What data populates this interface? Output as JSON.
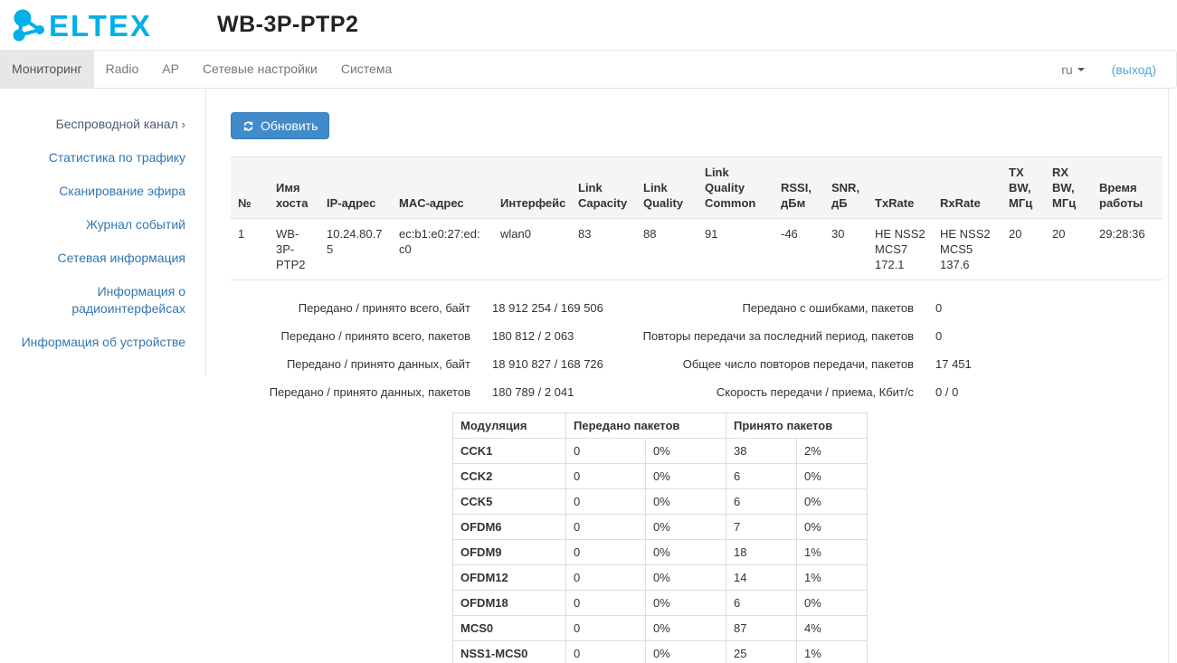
{
  "brand": {
    "logo_text": "ELTEX",
    "logo_color": "#00b0e6",
    "device_title": "WB-3P-PTP2"
  },
  "navbar": {
    "tabs": [
      {
        "label": "Мониторинг",
        "active": true
      },
      {
        "label": "Radio",
        "active": false
      },
      {
        "label": "AP",
        "active": false
      },
      {
        "label": "Сетевые настройки",
        "active": false
      },
      {
        "label": "Система",
        "active": false
      }
    ],
    "language": "ru",
    "logout_label": "(выход)"
  },
  "sidebar": {
    "items": [
      {
        "label": "Беспроводной канал",
        "chevron": "›",
        "active": true
      },
      {
        "label": "Статистика по трафику",
        "active": false
      },
      {
        "label": "Сканирование эфира",
        "active": false
      },
      {
        "label": "Журнал событий",
        "active": false
      },
      {
        "label": "Сетевая информация",
        "active": false
      },
      {
        "label": "Информация о радиоинтерфейсах",
        "active": false
      },
      {
        "label": "Информация об устройстве",
        "active": false
      }
    ]
  },
  "main": {
    "refresh_button": {
      "label": "Обновить"
    },
    "wireless_table": {
      "headers": [
        "№",
        "Имя хоста",
        "IP-адрес",
        "MAC-адрес",
        "Интерфейс",
        "Link Capacity",
        "Link Quality",
        "Link Quality Common",
        "RSSI, дБм",
        "SNR, дБ",
        "TxRate",
        "RxRate",
        "TX BW, МГц",
        "RX BW, МГц",
        "Время работы"
      ],
      "row": [
        "1",
        "WB-3P-PTP2",
        "10.24.80.75",
        "ec:b1:e0:27:ed:c0",
        "wlan0",
        "83",
        "88",
        "91",
        "-46",
        "30",
        "HE NSS2 MCS7 172.1",
        "HE NSS2 MCS5 137.6",
        "20",
        "20",
        "29:28:36"
      ]
    },
    "stats": {
      "left": [
        {
          "label": "Передано / принято всего, байт",
          "value": "18 912 254 / 169 506"
        },
        {
          "label": "Передано / принято всего, пакетов",
          "value": "180 812 / 2 063"
        },
        {
          "label": "Передано / принято данных, байт",
          "value": "18 910 827 / 168 726"
        },
        {
          "label": "Передано / принято данных, пакетов",
          "value": "180 789 / 2 041"
        }
      ],
      "right": [
        {
          "label": "Передано с ошибками, пакетов",
          "value": "0"
        },
        {
          "label": "Повторы передачи за последний период, пакетов",
          "value": "0"
        },
        {
          "label": "Общее число повторов передачи, пакетов",
          "value": "17 451"
        },
        {
          "label": "Скорость передачи / приема, Кбит/с",
          "value": "0 / 0"
        }
      ]
    },
    "modulation_table": {
      "headers": [
        "Модуляция",
        "Передано пакетов",
        "Принято пакетов"
      ],
      "rows": [
        {
          "name": "CCK1",
          "cells": [
            "0",
            "0%",
            "38",
            "2%"
          ]
        },
        {
          "name": "CCK2",
          "cells": [
            "0",
            "0%",
            "6",
            "0%"
          ]
        },
        {
          "name": "CCK5",
          "cells": [
            "0",
            "0%",
            "6",
            "0%"
          ]
        },
        {
          "name": "OFDM6",
          "cells": [
            "0",
            "0%",
            "7",
            "0%"
          ]
        },
        {
          "name": "OFDM9",
          "cells": [
            "0",
            "0%",
            "18",
            "1%"
          ]
        },
        {
          "name": "OFDM12",
          "cells": [
            "0",
            "0%",
            "14",
            "1%"
          ]
        },
        {
          "name": "OFDM18",
          "cells": [
            "0",
            "0%",
            "6",
            "0%"
          ]
        },
        {
          "name": "MCS0",
          "cells": [
            "0",
            "0%",
            "87",
            "4%"
          ]
        },
        {
          "name": "NSS1-MCS0",
          "cells": [
            "0",
            "0%",
            "25",
            "1%"
          ]
        }
      ]
    }
  },
  "colors": {
    "logo_blue": "#00b0e6",
    "accent_blue": "#428bca",
    "link_blue": "#3276b1",
    "logout_blue": "#53a7dc",
    "active_tab_bg": "#e7e7e7"
  }
}
